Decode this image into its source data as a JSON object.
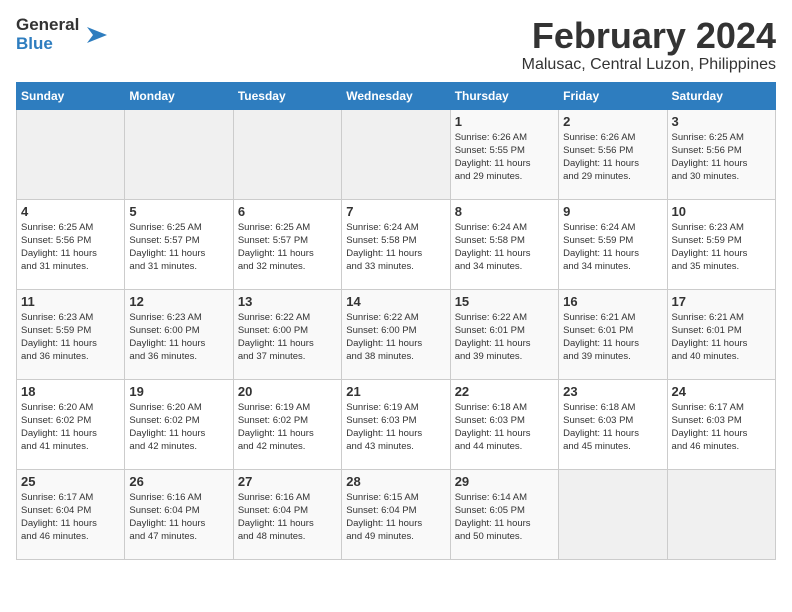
{
  "logo": {
    "line1": "General",
    "line2": "Blue"
  },
  "title": "February 2024",
  "location": "Malusac, Central Luzon, Philippines",
  "days_of_week": [
    "Sunday",
    "Monday",
    "Tuesday",
    "Wednesday",
    "Thursday",
    "Friday",
    "Saturday"
  ],
  "weeks": [
    [
      {
        "day": "",
        "info": ""
      },
      {
        "day": "",
        "info": ""
      },
      {
        "day": "",
        "info": ""
      },
      {
        "day": "",
        "info": ""
      },
      {
        "day": "1",
        "info": "Sunrise: 6:26 AM\nSunset: 5:55 PM\nDaylight: 11 hours\nand 29 minutes."
      },
      {
        "day": "2",
        "info": "Sunrise: 6:26 AM\nSunset: 5:56 PM\nDaylight: 11 hours\nand 29 minutes."
      },
      {
        "day": "3",
        "info": "Sunrise: 6:25 AM\nSunset: 5:56 PM\nDaylight: 11 hours\nand 30 minutes."
      }
    ],
    [
      {
        "day": "4",
        "info": "Sunrise: 6:25 AM\nSunset: 5:56 PM\nDaylight: 11 hours\nand 31 minutes."
      },
      {
        "day": "5",
        "info": "Sunrise: 6:25 AM\nSunset: 5:57 PM\nDaylight: 11 hours\nand 31 minutes."
      },
      {
        "day": "6",
        "info": "Sunrise: 6:25 AM\nSunset: 5:57 PM\nDaylight: 11 hours\nand 32 minutes."
      },
      {
        "day": "7",
        "info": "Sunrise: 6:24 AM\nSunset: 5:58 PM\nDaylight: 11 hours\nand 33 minutes."
      },
      {
        "day": "8",
        "info": "Sunrise: 6:24 AM\nSunset: 5:58 PM\nDaylight: 11 hours\nand 34 minutes."
      },
      {
        "day": "9",
        "info": "Sunrise: 6:24 AM\nSunset: 5:59 PM\nDaylight: 11 hours\nand 34 minutes."
      },
      {
        "day": "10",
        "info": "Sunrise: 6:23 AM\nSunset: 5:59 PM\nDaylight: 11 hours\nand 35 minutes."
      }
    ],
    [
      {
        "day": "11",
        "info": "Sunrise: 6:23 AM\nSunset: 5:59 PM\nDaylight: 11 hours\nand 36 minutes."
      },
      {
        "day": "12",
        "info": "Sunrise: 6:23 AM\nSunset: 6:00 PM\nDaylight: 11 hours\nand 36 minutes."
      },
      {
        "day": "13",
        "info": "Sunrise: 6:22 AM\nSunset: 6:00 PM\nDaylight: 11 hours\nand 37 minutes."
      },
      {
        "day": "14",
        "info": "Sunrise: 6:22 AM\nSunset: 6:00 PM\nDaylight: 11 hours\nand 38 minutes."
      },
      {
        "day": "15",
        "info": "Sunrise: 6:22 AM\nSunset: 6:01 PM\nDaylight: 11 hours\nand 39 minutes."
      },
      {
        "day": "16",
        "info": "Sunrise: 6:21 AM\nSunset: 6:01 PM\nDaylight: 11 hours\nand 39 minutes."
      },
      {
        "day": "17",
        "info": "Sunrise: 6:21 AM\nSunset: 6:01 PM\nDaylight: 11 hours\nand 40 minutes."
      }
    ],
    [
      {
        "day": "18",
        "info": "Sunrise: 6:20 AM\nSunset: 6:02 PM\nDaylight: 11 hours\nand 41 minutes."
      },
      {
        "day": "19",
        "info": "Sunrise: 6:20 AM\nSunset: 6:02 PM\nDaylight: 11 hours\nand 42 minutes."
      },
      {
        "day": "20",
        "info": "Sunrise: 6:19 AM\nSunset: 6:02 PM\nDaylight: 11 hours\nand 42 minutes."
      },
      {
        "day": "21",
        "info": "Sunrise: 6:19 AM\nSunset: 6:03 PM\nDaylight: 11 hours\nand 43 minutes."
      },
      {
        "day": "22",
        "info": "Sunrise: 6:18 AM\nSunset: 6:03 PM\nDaylight: 11 hours\nand 44 minutes."
      },
      {
        "day": "23",
        "info": "Sunrise: 6:18 AM\nSunset: 6:03 PM\nDaylight: 11 hours\nand 45 minutes."
      },
      {
        "day": "24",
        "info": "Sunrise: 6:17 AM\nSunset: 6:03 PM\nDaylight: 11 hours\nand 46 minutes."
      }
    ],
    [
      {
        "day": "25",
        "info": "Sunrise: 6:17 AM\nSunset: 6:04 PM\nDaylight: 11 hours\nand 46 minutes."
      },
      {
        "day": "26",
        "info": "Sunrise: 6:16 AM\nSunset: 6:04 PM\nDaylight: 11 hours\nand 47 minutes."
      },
      {
        "day": "27",
        "info": "Sunrise: 6:16 AM\nSunset: 6:04 PM\nDaylight: 11 hours\nand 48 minutes."
      },
      {
        "day": "28",
        "info": "Sunrise: 6:15 AM\nSunset: 6:04 PM\nDaylight: 11 hours\nand 49 minutes."
      },
      {
        "day": "29",
        "info": "Sunrise: 6:14 AM\nSunset: 6:05 PM\nDaylight: 11 hours\nand 50 minutes."
      },
      {
        "day": "",
        "info": ""
      },
      {
        "day": "",
        "info": ""
      }
    ]
  ]
}
